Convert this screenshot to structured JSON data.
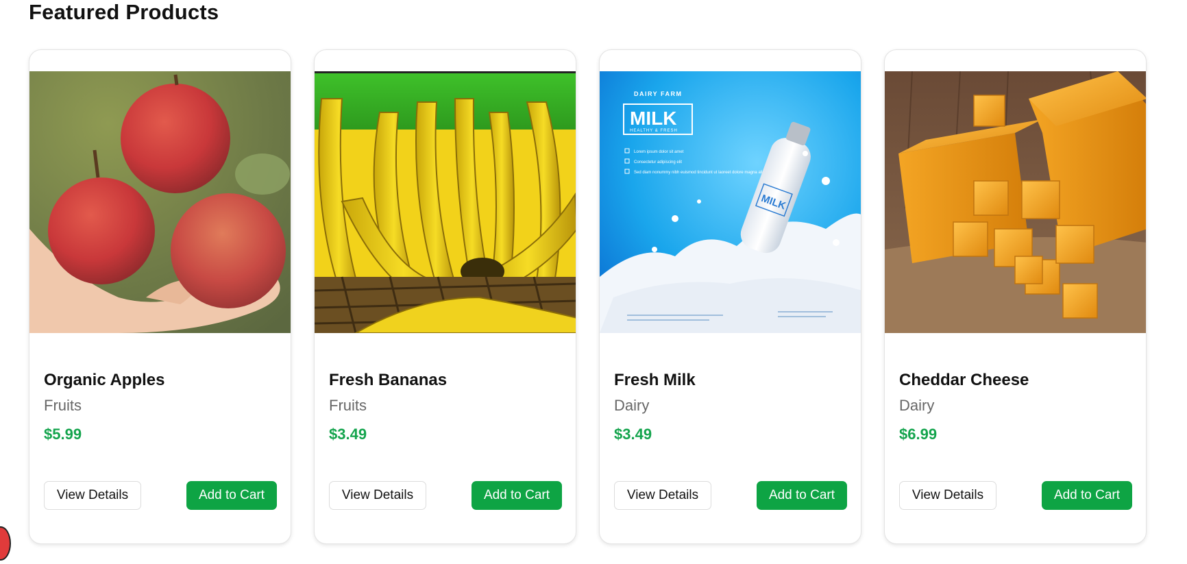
{
  "section": {
    "title": "Featured Products"
  },
  "products": [
    {
      "name": "Organic Apples",
      "category": "Fruits",
      "price": "$5.99",
      "image": "apples-photo"
    },
    {
      "name": "Fresh Bananas",
      "category": "Fruits",
      "price": "$3.49",
      "image": "bananas-photo"
    },
    {
      "name": "Fresh Milk",
      "category": "Dairy",
      "price": "$3.49",
      "image": "milk-ad-photo",
      "image_text": {
        "brand": "DAIRY FARM",
        "headline": "MILK",
        "tagline": "HEALTHY & FRESH",
        "bullets": [
          "Lorem ipsum dolor sit amet",
          "Consectetur adipiscing elit",
          "Sed diam nonummy nibh euismod tincidunt ut laoreet dolore magna aliquam erat volutpat"
        ]
      }
    },
    {
      "name": "Cheddar Cheese",
      "category": "Dairy",
      "price": "$6.99",
      "image": "cheese-photo"
    }
  ],
  "buttons": {
    "details_label": "View Details",
    "cart_label": "Add to Cart"
  },
  "colors": {
    "accent": "#0ea444",
    "price": "#14a44d",
    "muted": "#666666"
  }
}
